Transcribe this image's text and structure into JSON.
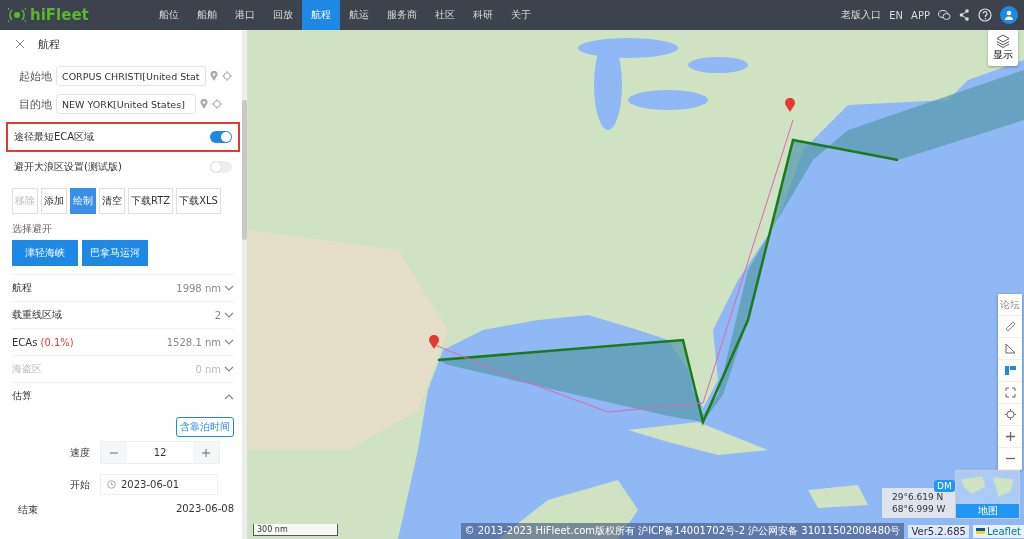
{
  "nav": {
    "logo": "hiFleet",
    "items": [
      {
        "label": "船位",
        "selected": false
      },
      {
        "label": "船舶",
        "selected": false
      },
      {
        "label": "港口",
        "selected": false
      },
      {
        "label": "回放",
        "selected": false
      },
      {
        "label": "航程",
        "selected": true
      },
      {
        "label": "航运",
        "selected": false
      },
      {
        "label": "服务商",
        "selected": false
      },
      {
        "label": "社区",
        "selected": false
      },
      {
        "label": "科研",
        "selected": false
      },
      {
        "label": "关于",
        "selected": false
      }
    ],
    "links": [
      "老版入口",
      "EN",
      "APP"
    ]
  },
  "panel": {
    "title": "航程",
    "origin": {
      "label": "起始地",
      "value": "CORPUS CHRISTI[United Stat"
    },
    "destination": {
      "label": "目的地",
      "value": "NEW YORK[United States]"
    },
    "toggles": [
      {
        "label": "途径最短ECA区域",
        "on": true,
        "highlighted": true
      },
      {
        "label": "避开大浪区设置(测试版)",
        "on": false,
        "highlighted": false
      }
    ],
    "actions": [
      {
        "label": "移除",
        "selected": false,
        "disabled": true
      },
      {
        "label": "添加",
        "selected": false,
        "disabled": false
      },
      {
        "label": "绘制",
        "selected": true,
        "disabled": false
      },
      {
        "label": "清空",
        "selected": false,
        "disabled": false
      },
      {
        "label": "下载RTZ",
        "selected": false,
        "disabled": false
      },
      {
        "label": "下载XLS",
        "selected": false,
        "disabled": false
      }
    ],
    "avoid": {
      "label": "选择避开",
      "buttons": [
        "津轻海峡",
        "巴拿马运河"
      ]
    },
    "stats": [
      {
        "label": "航程",
        "value": "1998 nm",
        "disabled": false
      },
      {
        "label": "载重线区域",
        "value": "2",
        "disabled": false
      },
      {
        "label": "ECAs",
        "note": "(0.1%)",
        "value": "1528.1 nm",
        "disabled": false
      },
      {
        "label": "海盗区",
        "value": "0 nm",
        "disabled": true
      }
    ],
    "estimate": {
      "label": "估算",
      "expanded": true,
      "badge": "含靠泊时间",
      "speed_label": "速度",
      "speed": "12",
      "start_label": "开始",
      "start": "2023-06-01",
      "end_label": "结束",
      "end": "2023-06-08"
    }
  },
  "map": {
    "display_button": "显示",
    "forum": "论坛",
    "latitude": "29°6.619 N",
    "longitude": "68°6.999 W",
    "format": "DM",
    "minimap_label": "地图",
    "scale": "300 nm",
    "copyright": "© 2013-2023 HiFleet.com版权所有 沪ICP备14001702号-2 沪公网安备 31011502008480号",
    "version": "Ver5.2.685",
    "attribution": "Leaflet"
  }
}
